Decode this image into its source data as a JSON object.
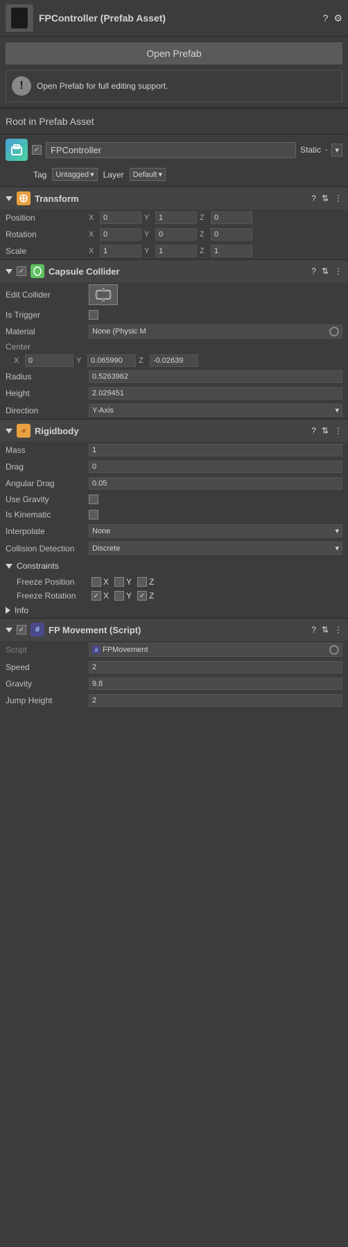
{
  "header": {
    "title": "FPController (Prefab Asset)",
    "help_icon": "?",
    "settings_icon": "⚙"
  },
  "open_prefab": {
    "button_label": "Open Prefab",
    "warning_text": "Open Prefab for full editing support."
  },
  "root_label": "Root in Prefab Asset",
  "game_object": {
    "name": "FPController",
    "static_label": "Static",
    "tag_label": "Tag",
    "tag_value": "Untagged",
    "layer_label": "Layer",
    "layer_value": "Default"
  },
  "transform": {
    "title": "Transform",
    "position_label": "Position",
    "position_x": "0",
    "position_y": "1",
    "position_z": "0",
    "rotation_label": "Rotation",
    "rotation_x": "0",
    "rotation_y": "0",
    "rotation_z": "0",
    "scale_label": "Scale",
    "scale_x": "1",
    "scale_y": "1",
    "scale_z": "1"
  },
  "capsule_collider": {
    "title": "Capsule Collider",
    "edit_label": "Edit Collider",
    "is_trigger_label": "Is Trigger",
    "material_label": "Material",
    "material_value": "None (Physic M",
    "center_label": "Center",
    "center_x": "0",
    "center_y": "0.065990",
    "center_z": "-0.02639",
    "radius_label": "Radius",
    "radius_value": "0.5263962",
    "height_label": "Height",
    "height_value": "2.029451",
    "direction_label": "Direction",
    "direction_value": "Y-Axis"
  },
  "rigidbody": {
    "title": "Rigidbody",
    "mass_label": "Mass",
    "mass_value": "1",
    "drag_label": "Drag",
    "drag_value": "0",
    "angular_drag_label": "Angular Drag",
    "angular_drag_value": "0.05",
    "use_gravity_label": "Use Gravity",
    "is_kinematic_label": "Is Kinematic",
    "interpolate_label": "Interpolate",
    "interpolate_value": "None",
    "collision_detection_label": "Collision Detection",
    "collision_detection_value": "Discrete",
    "constraints_label": "Constraints",
    "freeze_position_label": "Freeze Position",
    "freeze_rotation_label": "Freeze Rotation",
    "info_label": "Info"
  },
  "fp_movement": {
    "title": "FP Movement (Script)",
    "script_label": "Script",
    "script_value": "FPMovement",
    "speed_label": "Speed",
    "speed_value": "2",
    "gravity_label": "Gravity",
    "gravity_value": "9.8",
    "jump_height_label": "Jump Height",
    "jump_height_value": "2"
  }
}
